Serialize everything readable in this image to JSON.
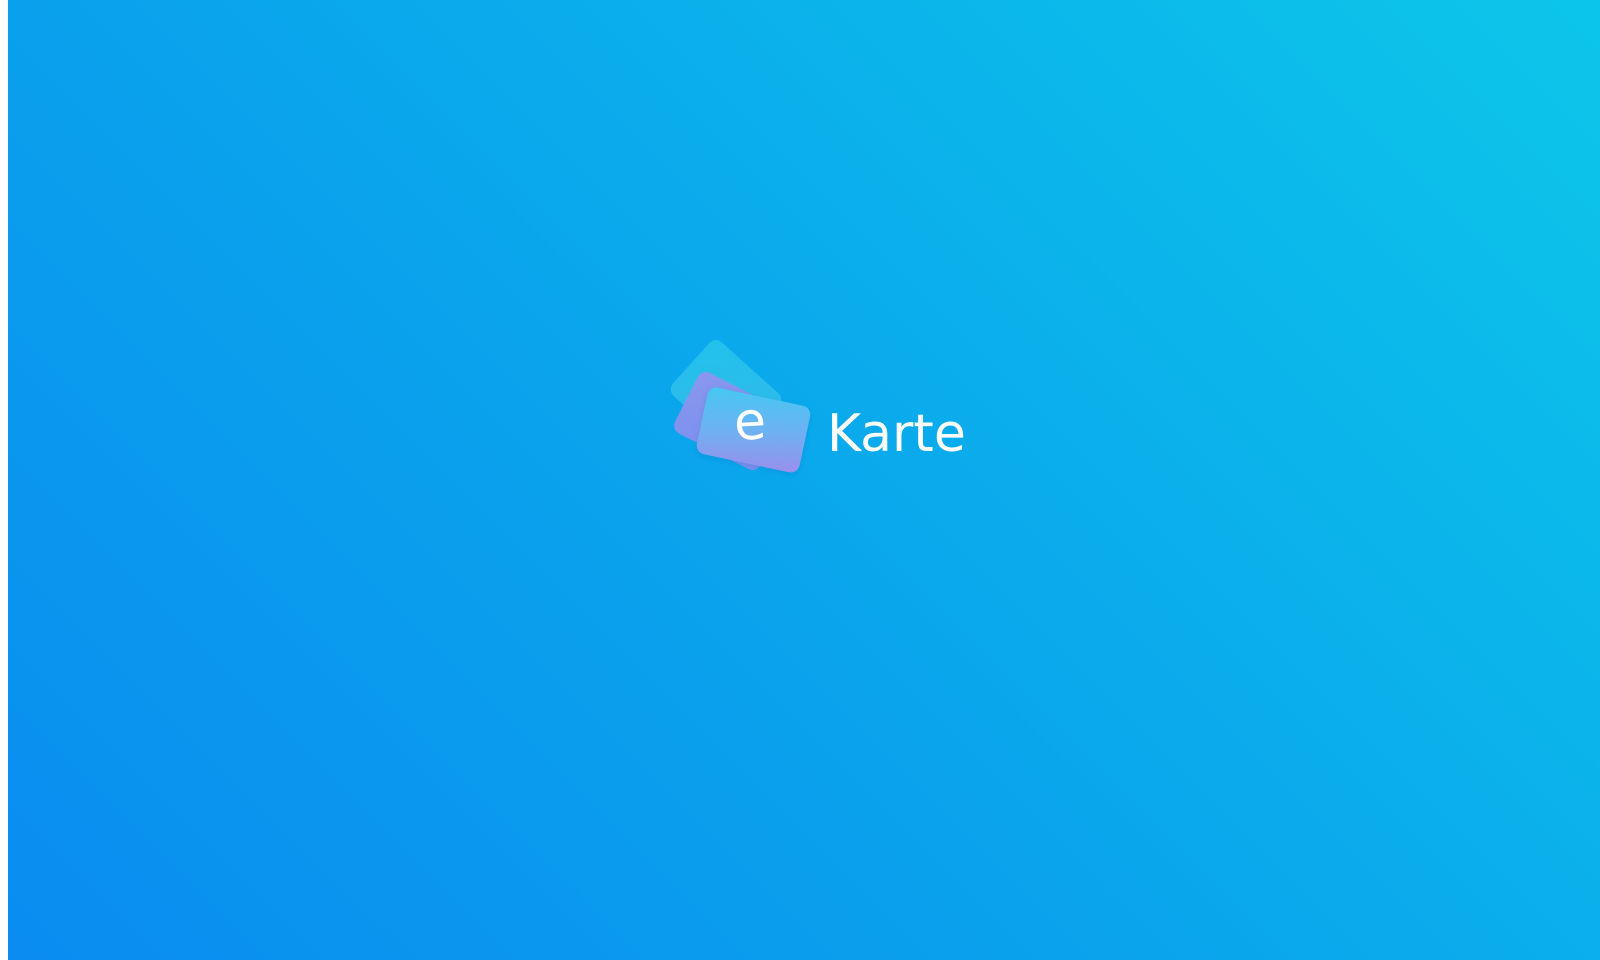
{
  "app": {
    "logo_icon": "stacked-cards-logo",
    "logo_letter": "e",
    "name": "Karte"
  },
  "colors": {
    "background_start": "#0a8cf0",
    "background_end": "#0cc6ea",
    "card_back": "#22c3ec",
    "card_middle": "#8e94ee",
    "card_front_top": "#45c8f2",
    "card_front_bottom": "#9a8eec",
    "text": "#ffffff"
  }
}
